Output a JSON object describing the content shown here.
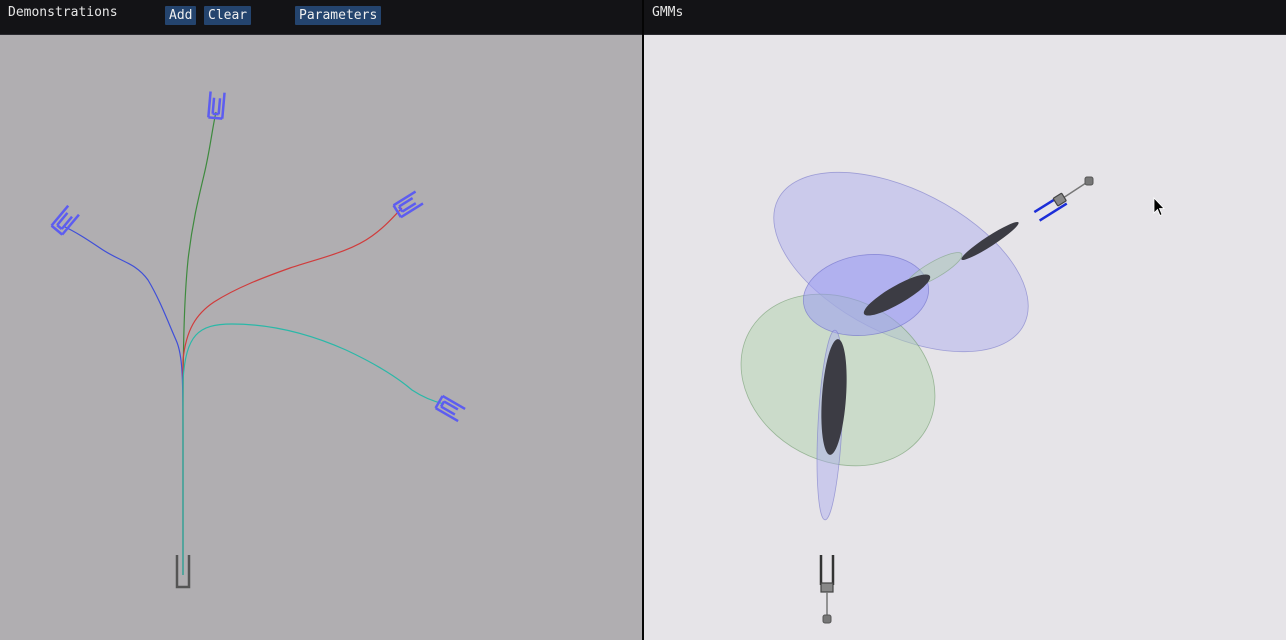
{
  "left_window": {
    "title": "Demonstrations",
    "buttons": {
      "add": "Add",
      "clear": "Clear",
      "parameters": "Parameters"
    }
  },
  "right_window": {
    "title": "GMMs"
  },
  "colors": {
    "left_canvas_bg": "#b0aeb1",
    "right_canvas_bg": "#e6e4e8",
    "button_bg": "#24446e",
    "gripper_target": "#5d5df0",
    "gripper_start": "#555555",
    "trajectory_blue": "#3f4fd8",
    "trajectory_green": "#3e8a3e",
    "trajectory_red": "#d03c3c",
    "trajectory_teal": "#2ab8a8",
    "gaussian_blue": "#a8a8f0",
    "gaussian_green": "#b4d0b0",
    "gaussian_core": "#3c3c44",
    "robot_gripper": "#1c2ed8"
  },
  "icons": {
    "cursor": "mouse-pointer-icon"
  }
}
